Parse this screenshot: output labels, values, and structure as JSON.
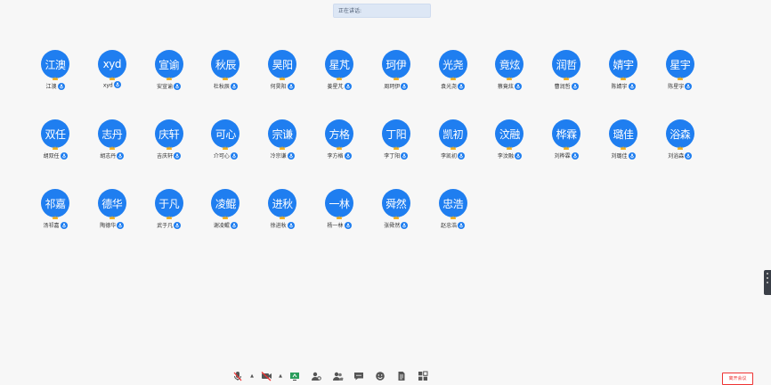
{
  "banner": {
    "text": "正在讲话:"
  },
  "participants": [
    {
      "avatar": "江澳",
      "name": "江澳"
    },
    {
      "avatar": "xyd",
      "name": "xyd"
    },
    {
      "avatar": "宣谕",
      "name": "安宣谕"
    },
    {
      "avatar": "秋辰",
      "name": "杜秋辰"
    },
    {
      "avatar": "昊阳",
      "name": "何昊阳"
    },
    {
      "avatar": "星芃",
      "name": "姜星芃"
    },
    {
      "avatar": "珂伊",
      "name": "周珂伊"
    },
    {
      "avatar": "光尧",
      "name": "袁光尧"
    },
    {
      "avatar": "竟炫",
      "name": "蔡竟炫"
    },
    {
      "avatar": "润哲",
      "name": "曹润哲"
    },
    {
      "avatar": "婧宇",
      "name": "陈婧宇"
    },
    {
      "avatar": "星宇",
      "name": "陈星宇"
    },
    {
      "avatar": "双任",
      "name": "胡双任"
    },
    {
      "avatar": "志丹",
      "name": "胡志丹"
    },
    {
      "avatar": "庆轩",
      "name": "吉庆轩"
    },
    {
      "avatar": "可心",
      "name": "介可心"
    },
    {
      "avatar": "宗谦",
      "name": "冷宗谦"
    },
    {
      "avatar": "方格",
      "name": "李方格"
    },
    {
      "avatar": "丁阳",
      "name": "李丁阳"
    },
    {
      "avatar": "凯初",
      "name": "李凯初"
    },
    {
      "avatar": "汶融",
      "name": "李汶融"
    },
    {
      "avatar": "桦霖",
      "name": "刘桦霖"
    },
    {
      "avatar": "璐佳",
      "name": "刘璐佳"
    },
    {
      "avatar": "浴森",
      "name": "刘浴森"
    },
    {
      "avatar": "祁嘉",
      "name": "汤祁嘉"
    },
    {
      "avatar": "德华",
      "name": "陶德华"
    },
    {
      "avatar": "于凡",
      "name": "武于凡"
    },
    {
      "avatar": "凌鲲",
      "name": "谢凌鲲"
    },
    {
      "avatar": "进秋",
      "name": "徐进秋"
    },
    {
      "avatar": "一林",
      "name": "杨一林"
    },
    {
      "avatar": "舜然",
      "name": "张舜然"
    },
    {
      "avatar": "忠浩",
      "name": "赵忠浩"
    }
  ],
  "toolbar": [
    "mic-muted-icon",
    "video-off-icon",
    "share-screen-icon",
    "manage-members-icon",
    "members-icon",
    "chat-icon",
    "reaction-icon",
    "document-icon",
    "apps-icon"
  ],
  "leave_label": "离开会议",
  "colors": {
    "avatar": "#1f7ef0",
    "leave": "#ee3333"
  }
}
